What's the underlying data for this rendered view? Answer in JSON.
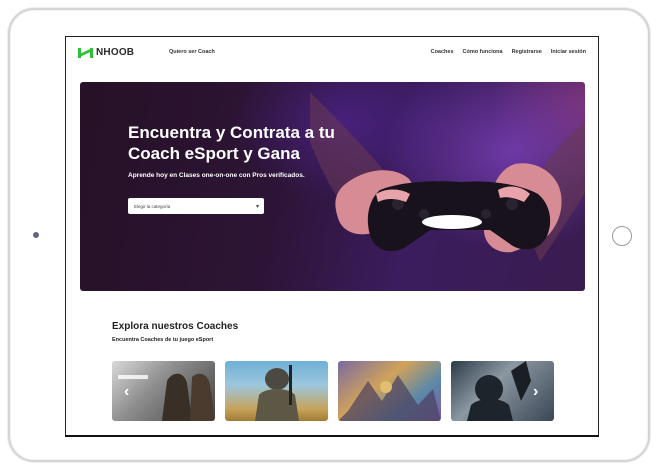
{
  "nav": {
    "logo": "NHOOB",
    "coach_link": "Quiero ser Coach",
    "links": [
      "Coaches",
      "Cómo funciona",
      "Registrarse",
      "Iniciar sesión"
    ]
  },
  "hero": {
    "title": "Encuentra y Contrata a tu Coach eSport y Gana",
    "subtitle": "Aprende hoy en Clases one-on-one con Pros verificados.",
    "select_placeholder": "Elegir la categoría"
  },
  "explore": {
    "title": "Explora nuestros Coaches",
    "subtitle": "Encuentra Coaches de tu juego eSport"
  },
  "colors": {
    "brand_green": "#2fbf3a",
    "hero_purple": "#3b1c5e"
  },
  "icons": {
    "select_chevron": "chevron-down-icon",
    "carousel_prev": "chevron-left-icon",
    "carousel_next": "chevron-right-icon"
  }
}
